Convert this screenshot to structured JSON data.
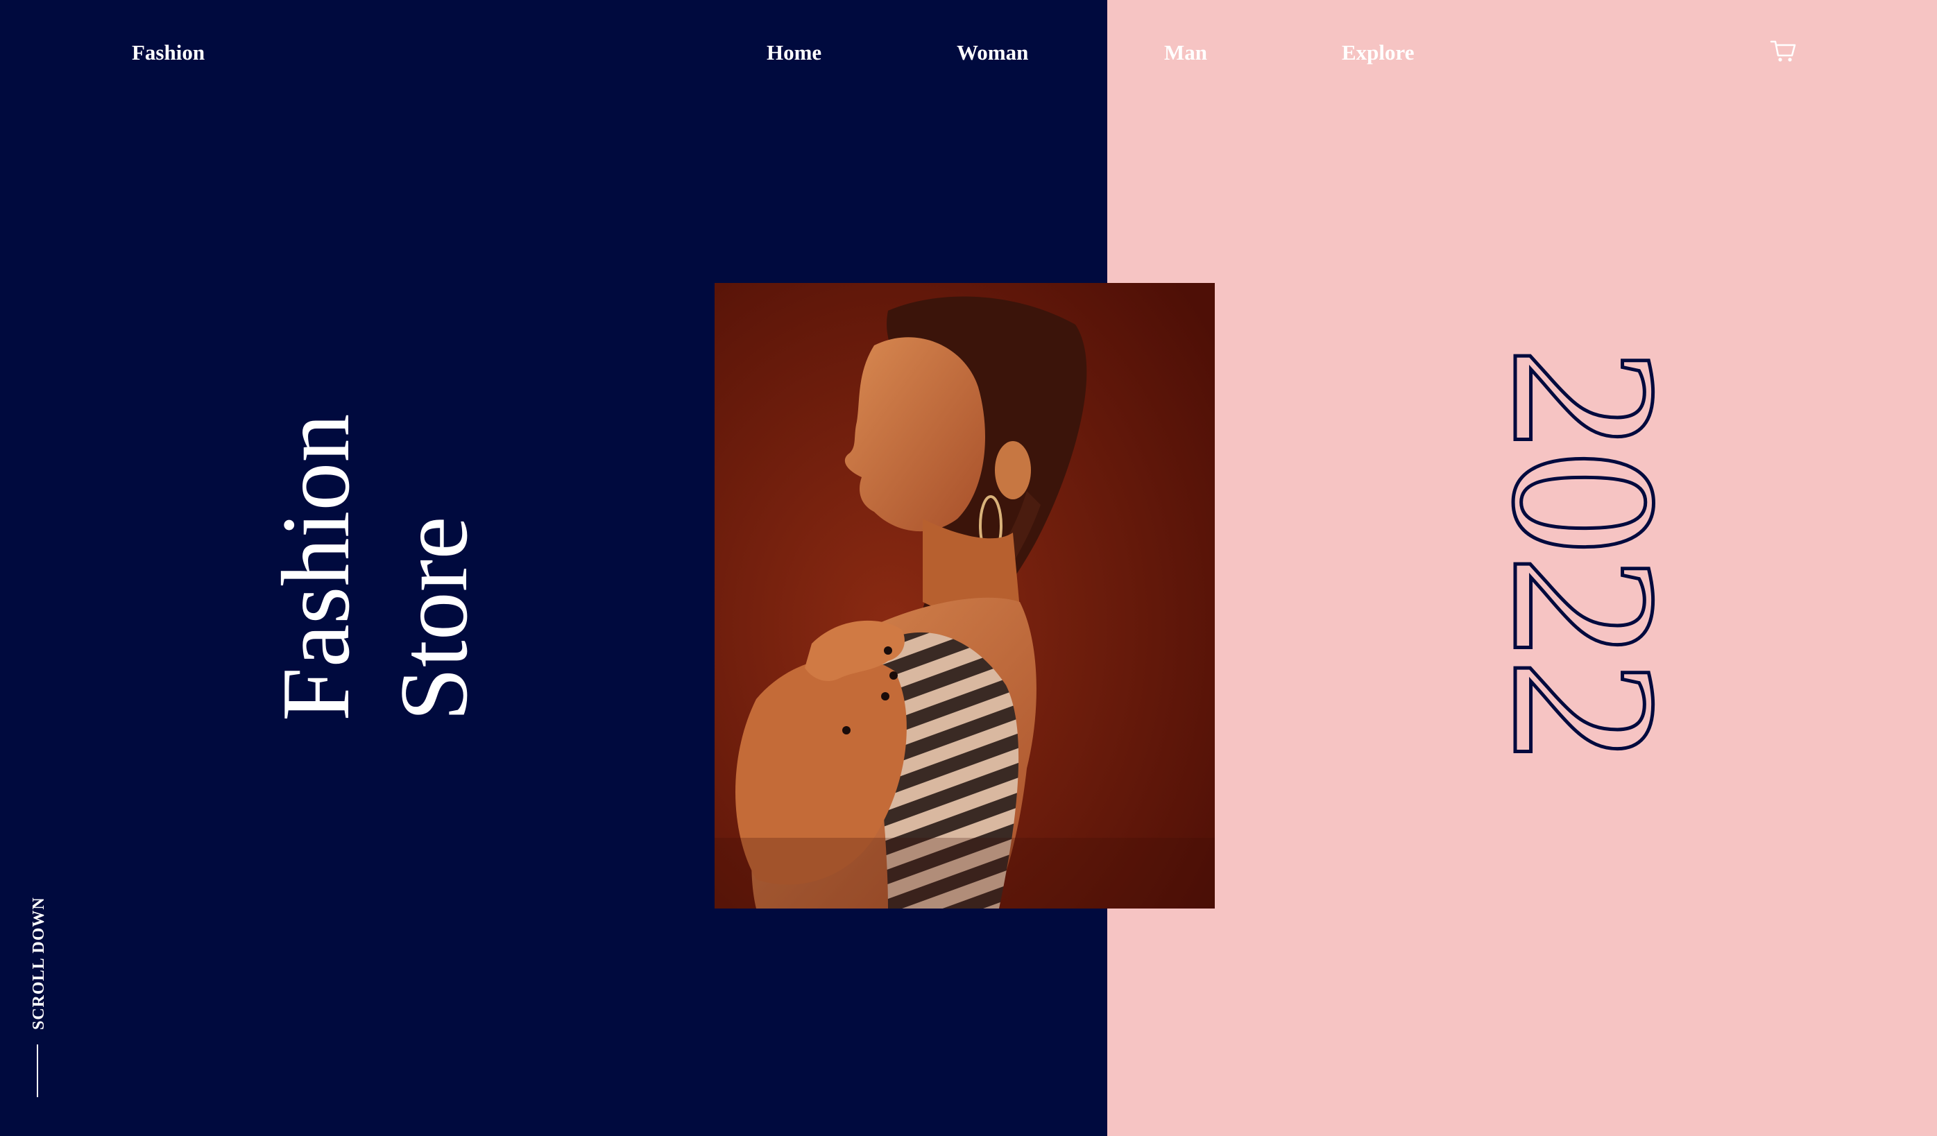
{
  "brand": {
    "logo": "Fashion"
  },
  "nav": {
    "items": [
      {
        "label": "Home"
      },
      {
        "label": "Woman"
      },
      {
        "label": "Man"
      },
      {
        "label": "Explore"
      }
    ],
    "cart_icon": "cart-icon"
  },
  "hero": {
    "title_line1": "Fashion",
    "title_line2": "Store",
    "year": "2022",
    "image": "model-portrait-image"
  },
  "scroll": {
    "label": "SCROLL DOWN"
  },
  "colors": {
    "navy": "#000a3e",
    "pink": "#f6c4c3",
    "white": "#ffffff",
    "photo_background": "#7a1e0e"
  }
}
